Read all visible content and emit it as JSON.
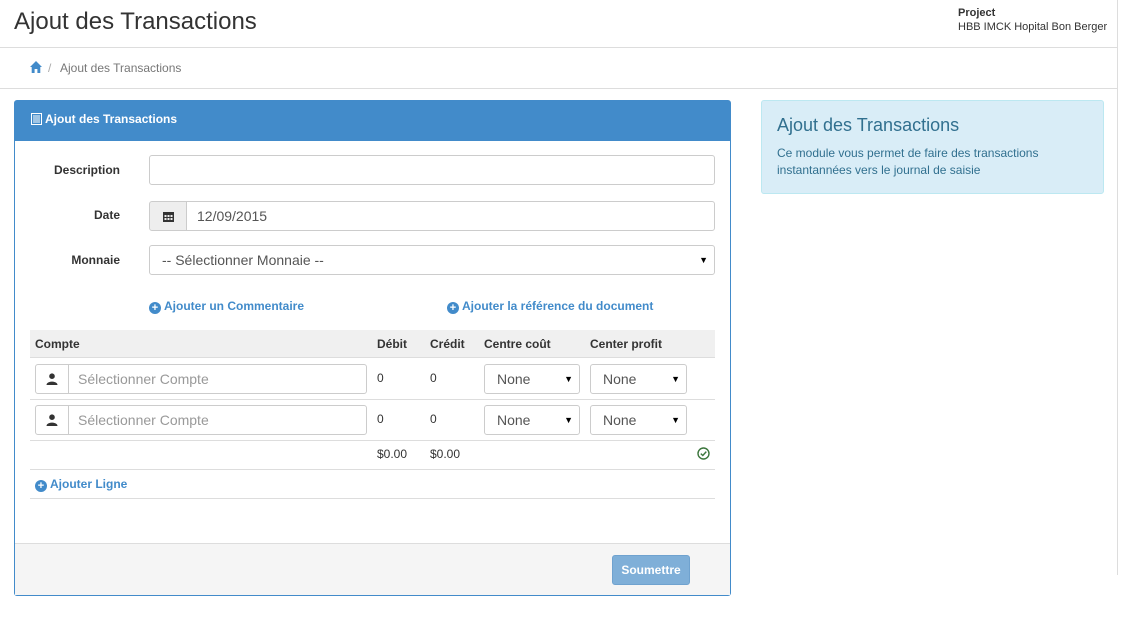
{
  "header": {
    "title": "Ajout des Transactions",
    "project_label": "Project",
    "project_name": "HBB IMCK Hopital Bon Berger"
  },
  "breadcrumb": {
    "home_icon": "home-icon",
    "current": "Ajout des Transactions"
  },
  "form_panel": {
    "title": "Ajout des Transactions",
    "title_icon": "list-alt-icon",
    "description_label": "Description",
    "description_value": "",
    "date_label": "Date",
    "date_value": "12/09/2015",
    "date_icon": "calendar-icon",
    "currency_label": "Monnaie",
    "currency_selected": "-- Sélectionner Monnaie --",
    "add_comment": "Ajouter un Commentaire",
    "add_reference": "Ajouter la référence du document",
    "table": {
      "headers": [
        "Compte",
        "Débit",
        "Crédit",
        "Centre coût",
        "Center profit"
      ],
      "rows": [
        {
          "compte_placeholder": "Sélectionner Compte",
          "debit": "0",
          "credit": "0",
          "centre_cout": "None",
          "center_profit": "None"
        },
        {
          "compte_placeholder": "Sélectionner Compte",
          "debit": "0",
          "credit": "0",
          "centre_cout": "None",
          "center_profit": "None"
        }
      ],
      "total_debit": "$0.00",
      "total_credit": "$0.00",
      "status_icon": "check-circle-icon"
    },
    "add_line": "Ajouter Ligne",
    "submit_label": "Soumettre"
  },
  "info_panel": {
    "title": "Ajout des Transactions",
    "text": "Ce module vous permet de faire des transactions instantannées vers le journal de saisie"
  },
  "colors": {
    "primary": "#428bca",
    "info_bg": "#d9edf7",
    "info_text": "#31708f",
    "success": "#3c763d"
  }
}
